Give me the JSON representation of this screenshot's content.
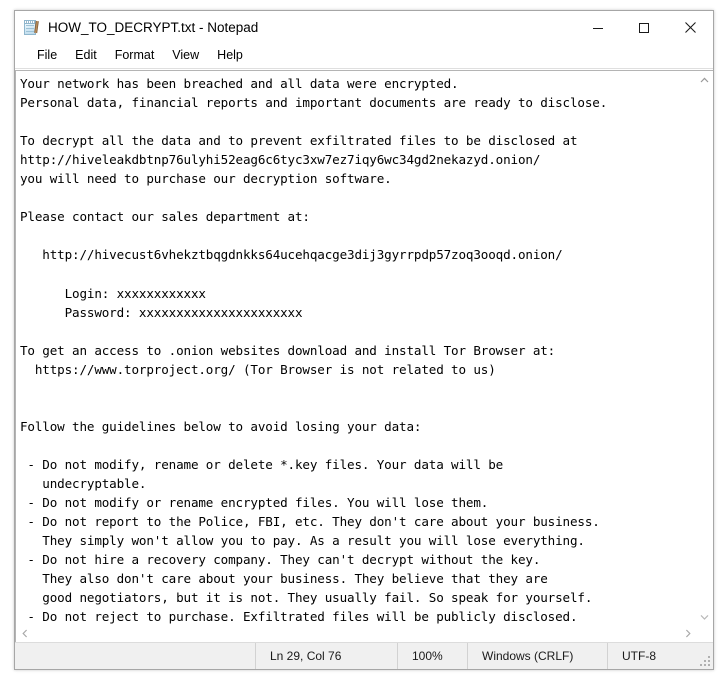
{
  "window": {
    "title": "HOW_TO_DECRYPT.txt - Notepad",
    "icon": "notepad-icon",
    "controls": {
      "minimize": "minimize-icon",
      "maximize": "maximize-icon",
      "close": "close-icon"
    }
  },
  "menu": {
    "items": [
      {
        "label": "File"
      },
      {
        "label": "Edit"
      },
      {
        "label": "Format"
      },
      {
        "label": "View"
      },
      {
        "label": "Help"
      }
    ]
  },
  "editor": {
    "text": "Your network has been breached and all data were encrypted.\nPersonal data, financial reports and important documents are ready to disclose.\n\nTo decrypt all the data and to prevent exfiltrated files to be disclosed at\nhttp://hiveleakdbtnp76ulyhi52eag6c6tyc3xw7ez7iqy6wc34gd2nekazyd.onion/\nyou will need to purchase our decryption software.\n\nPlease contact our sales department at:\n\n   http://hivecust6vhekztbqgdnkks64ucehqacge3dij3gyrrpdp57zoq3ooqd.onion/\n\n      Login: xxxxxxxxxxxx\n      Password: xxxxxxxxxxxxxxxxxxxxxx\n\nTo get an access to .onion websites download and install Tor Browser at:\n  https://www.torproject.org/ (Tor Browser is not related to us)\n\n\nFollow the guidelines below to avoid losing your data:\n\n - Do not modify, rename or delete *.key files. Your data will be\n   undecryptable.\n - Do not modify or rename encrypted files. You will lose them.\n - Do not report to the Police, FBI, etc. They don't care about your business.\n   They simply won't allow you to pay. As a result you will lose everything.\n - Do not hire a recovery company. They can't decrypt without the key.\n   They also don't care about your business. They believe that they are\n   good negotiators, but it is not. They usually fail. So speak for yourself.\n - Do not reject to purchase. Exfiltrated files will be publicly disclosed.",
    "lines": [
      "Your network has been breached and all data were encrypted.",
      "Personal data, financial reports and important documents are ready to disclose.",
      "",
      "To decrypt all the data and to prevent exfiltrated files to be disclosed at",
      "http://hiveleakdbtnp76ulyhi52eag6c6tyc3xw7ez7iqy6wc34gd2nekazyd.onion/",
      "you will need to purchase our decryption software.",
      "",
      "Please contact our sales department at:",
      "",
      "   http://hivecust6vhekztbqgdnkks64ucehqacge3dij3gyrrpdp57zoq3ooqd.onion/",
      "",
      "      Login: xxxxxxxxxxxx",
      "      Password: xxxxxxxxxxxxxxxxxxxxxx",
      "",
      "To get an access to .onion websites download and install Tor Browser at:",
      "  https://www.torproject.org/ (Tor Browser is not related to us)",
      "",
      "",
      "Follow the guidelines below to avoid losing your data:",
      "",
      " - Do not modify, rename or delete *.key files. Your data will be",
      "   undecryptable.",
      " - Do not modify or rename encrypted files. You will lose them.",
      " - Do not report to the Police, FBI, etc. They don't care about your business.",
      "   They simply won't allow you to pay. As a result you will lose everything.",
      " - Do not hire a recovery company. They can't decrypt without the key.",
      "   They also don't care about your business. They believe that they are",
      "   good negotiators, but it is not. They usually fail. So speak for yourself.",
      " - Do not reject to purchase. Exfiltrated files will be publicly disclosed."
    ],
    "urls": {
      "leak_site": "http://hiveleakdbtnp76ulyhi52eag6c6tyc3xw7ez7iqy6wc34gd2nekazyd.onion/",
      "support_site": "http://hivecust6vhekztbqgdnkks64ucehqacge3dij3gyrrpdp57zoq3ooqd.onion/",
      "tor_browser": "https://www.torproject.org/"
    },
    "credentials": {
      "login": "xxxxxxxxxxxx",
      "password": "xxxxxxxxxxxxxxxxxxxxxx"
    }
  },
  "scrollbars": {
    "vertical": {
      "up_arrow": "chevron-up-icon",
      "down_arrow": "chevron-down-icon"
    },
    "horizontal": {
      "left_arrow": "chevron-left-icon",
      "right_arrow": "chevron-right-icon"
    }
  },
  "status_bar": {
    "cursor_position": "Ln 29, Col 76",
    "zoom": "100%",
    "line_ending": "Windows (CRLF)",
    "encoding": "UTF-8"
  },
  "colors": {
    "window_background": "#f0f0f0",
    "editor_background": "#ffffff",
    "window_border": "#a6a6a6",
    "text": "#000000",
    "status_text": "#1a1a1a"
  }
}
